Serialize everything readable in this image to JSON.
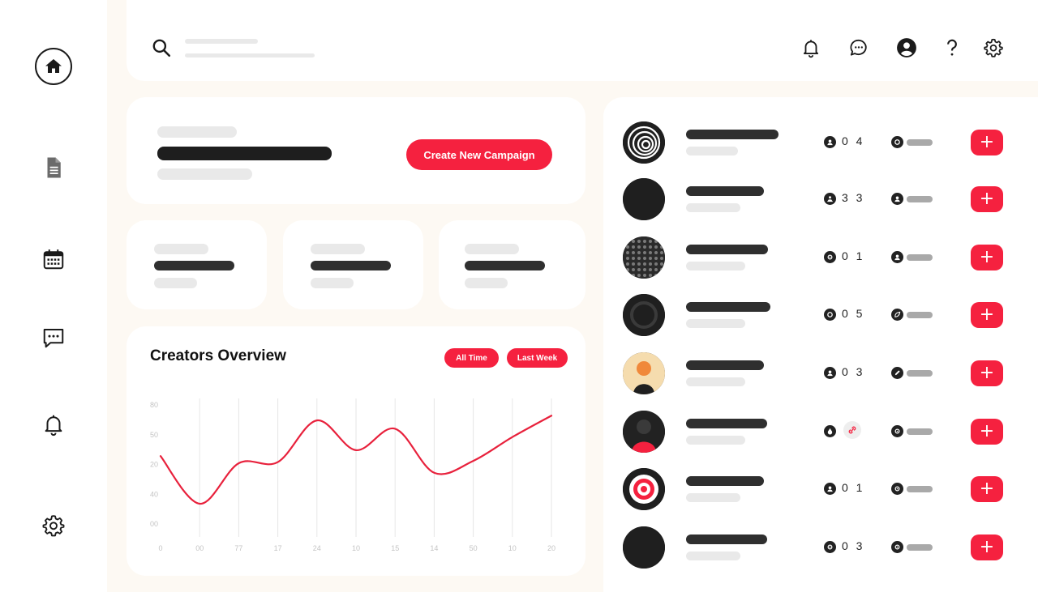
{
  "header": {
    "icons": [
      "search-icon",
      "bell-icon",
      "chat-icon",
      "user-icon",
      "help-icon",
      "gear-icon"
    ]
  },
  "sidebar": {
    "items": [
      {
        "icon": "home-icon",
        "active": true
      },
      {
        "icon": "document-icon"
      },
      {
        "icon": "calendar-icon"
      },
      {
        "icon": "chat-icon"
      },
      {
        "icon": "bell-icon"
      },
      {
        "icon": "gear-icon"
      }
    ]
  },
  "campaign": {
    "button_label": "Create New Campaign"
  },
  "overview": {
    "title": "Creators Overview",
    "filters": [
      "All Time",
      "Last Week"
    ]
  },
  "chart_data": {
    "type": "line",
    "title": "Creators Overview",
    "y_tick_labels": [
      "80",
      "50",
      "20",
      "40",
      "00"
    ],
    "x_tick_labels": [
      "0",
      "00",
      "77",
      "17",
      "24",
      "10",
      "15",
      "14",
      "50",
      "10",
      "20"
    ],
    "series": [
      {
        "color": "#e8213c",
        "points": [
          [
            0,
            57
          ],
          [
            1,
            17
          ],
          [
            2,
            51
          ],
          [
            3,
            52
          ],
          [
            4,
            87
          ],
          [
            5,
            62
          ],
          [
            6,
            80
          ],
          [
            7,
            43
          ],
          [
            8,
            53
          ],
          [
            9,
            73
          ],
          [
            10,
            91
          ]
        ]
      }
    ],
    "grid": true,
    "legend": "none"
  },
  "creators": [
    {
      "avatar": "spiral",
      "stat_icon": "user-icon",
      "count": "0 4",
      "meta_icon": "circle-icon"
    },
    {
      "avatar": "solid",
      "stat_icon": "users-icon",
      "count": "3 3",
      "meta_icon": "user-icon"
    },
    {
      "avatar": "dots",
      "stat_icon": "gear-icon",
      "count": "0 1",
      "meta_icon": "user-icon"
    },
    {
      "avatar": "ring",
      "stat_icon": "circle-icon",
      "count": "0 5",
      "meta_icon": "leaf-icon"
    },
    {
      "avatar": "person",
      "stat_icon": "user-icon",
      "count": "0 3",
      "meta_icon": "pencil-icon"
    },
    {
      "avatar": "person-dark",
      "stat_icon": "drop-icon",
      "count": "",
      "link_icon": "link-icon",
      "meta_icon": "gear-icon"
    },
    {
      "avatar": "target",
      "stat_icon": "user-icon",
      "count": "0 1",
      "meta_icon": "gear-icon"
    },
    {
      "avatar": "solid",
      "stat_icon": "gear-icon",
      "count": "0 3",
      "meta_icon": "gear-icon"
    }
  ],
  "colors": {
    "accent": "#f5213f",
    "background": "#fdf9f3",
    "card": "#ffffff",
    "text_dark": "#1b1b1b"
  }
}
